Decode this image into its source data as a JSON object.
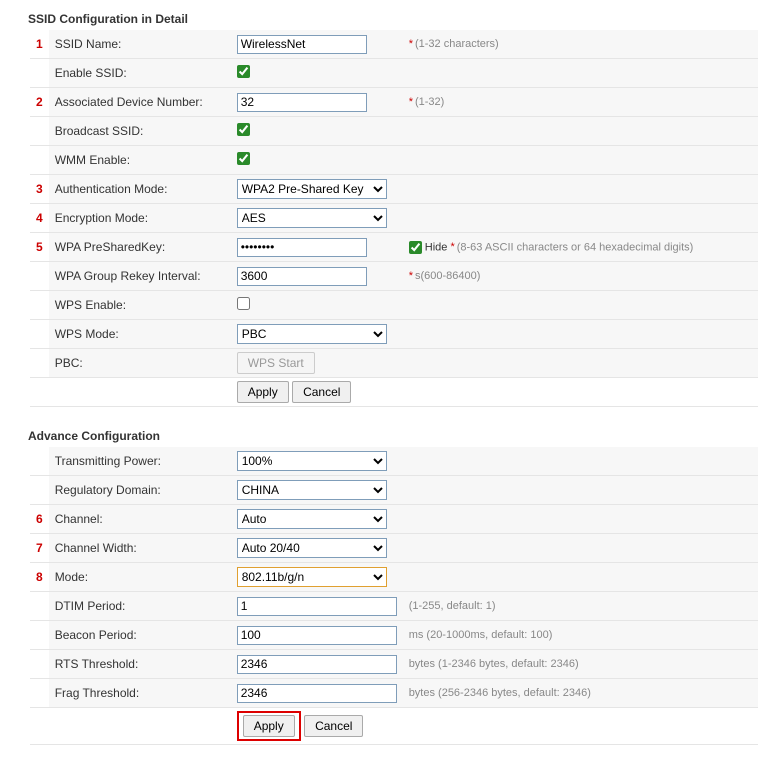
{
  "markers": [
    "1",
    "2",
    "3",
    "4",
    "5",
    "6",
    "7",
    "8"
  ],
  "ssid_section": {
    "title": "SSID Configuration in Detail",
    "rows": {
      "ssid_name": {
        "label": "SSID Name:",
        "value": "WirelessNet",
        "hint": "(1-32 characters)",
        "ast": true
      },
      "enable_ssid": {
        "label": "Enable SSID:",
        "checked": true
      },
      "assoc_dev": {
        "label": "Associated Device Number:",
        "value": "32",
        "hint": "(1-32)",
        "ast": true
      },
      "broadcast_ssid": {
        "label": "Broadcast SSID:",
        "checked": true
      },
      "wmm_enable": {
        "label": "WMM Enable:",
        "checked": true
      },
      "auth_mode": {
        "label": "Authentication Mode:",
        "value": "WPA2 Pre-Shared Key"
      },
      "enc_mode": {
        "label": "Encryption Mode:",
        "value": "AES"
      },
      "psk": {
        "label": "WPA PreSharedKey:",
        "value": "••••••••",
        "hide_label": "Hide",
        "hide_checked": true,
        "hint": "(8-63 ASCII characters or 64 hexadecimal digits)",
        "ast": true
      },
      "group_rekey": {
        "label": "WPA Group Rekey Interval:",
        "value": "3600",
        "hint": "s(600-86400)",
        "ast": true
      },
      "wps_enable": {
        "label": "WPS Enable:",
        "checked": false
      },
      "wps_mode": {
        "label": "WPS Mode:",
        "value": "PBC"
      },
      "pbc": {
        "label": "PBC:",
        "button": "WPS Start"
      }
    },
    "buttons": {
      "apply": "Apply",
      "cancel": "Cancel"
    }
  },
  "adv_section": {
    "title": "Advance Configuration",
    "rows": {
      "tx_power": {
        "label": "Transmitting Power:",
        "value": "100%"
      },
      "reg_domain": {
        "label": "Regulatory Domain:",
        "value": "CHINA"
      },
      "channel": {
        "label": "Channel:",
        "value": "Auto"
      },
      "chan_width": {
        "label": "Channel Width:",
        "value": "Auto 20/40"
      },
      "mode": {
        "label": "Mode:",
        "value": "802.11b/g/n"
      },
      "dtim": {
        "label": "DTIM Period:",
        "value": "1",
        "hint": "(1-255, default: 1)"
      },
      "beacon": {
        "label": "Beacon Period:",
        "value": "100",
        "hint": "ms (20-1000ms, default: 100)"
      },
      "rts": {
        "label": "RTS Threshold:",
        "value": "2346",
        "hint": "bytes (1-2346 bytes, default: 2346)"
      },
      "frag": {
        "label": "Frag Threshold:",
        "value": "2346",
        "hint": "bytes (256-2346 bytes, default: 2346)"
      }
    },
    "buttons": {
      "apply": "Apply",
      "cancel": "Cancel"
    }
  }
}
